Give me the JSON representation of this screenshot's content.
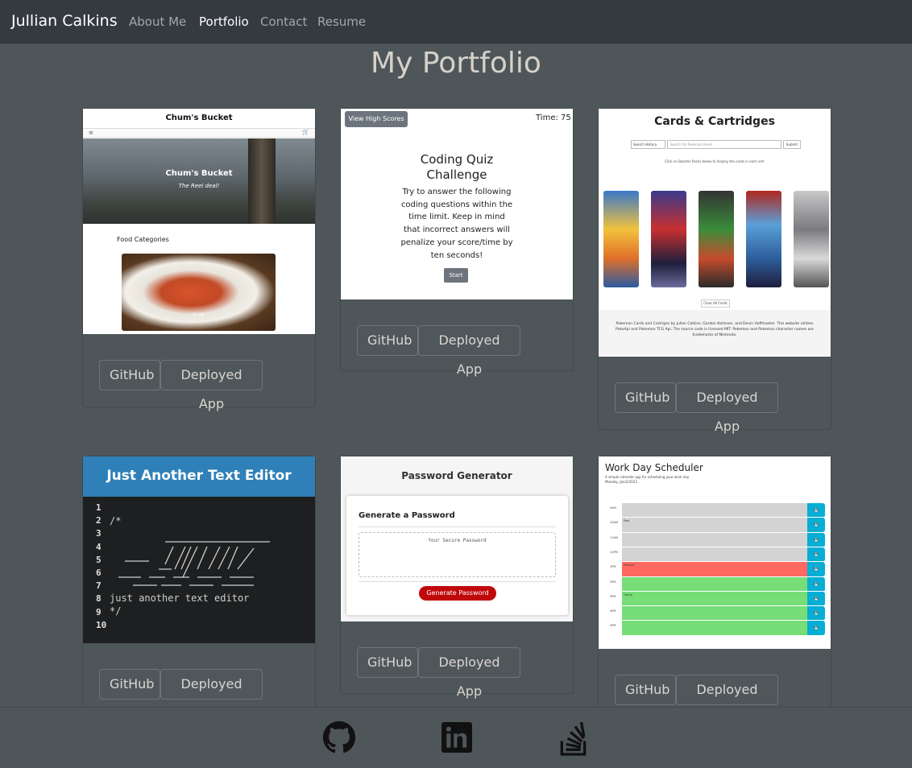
{
  "nav": {
    "brand": "Jullian Calkins",
    "links": [
      "About Me",
      "Portfolio",
      "Contact",
      "Resume"
    ],
    "active": "Portfolio"
  },
  "page_title": "My Portfolio",
  "cards": [
    {
      "id": "chums-bucket",
      "preview": {
        "title": "Chum's Bucket",
        "hero_title": "Chum's Bucket",
        "hero_tagline": "The Reel deal!",
        "section_label": "Food Categories",
        "image_caption": "Crab"
      },
      "github_label": "GitHub",
      "deployed_label": "Deployed App"
    },
    {
      "id": "coding-quiz",
      "preview": {
        "high_scores_label": "View High Scores",
        "timer": "Time: 75",
        "heading": "Coding Quiz Challenge",
        "instructions": "Try to answer the following coding questions within the time limit. Keep in mind that incorrect answers will penalize your score/time by ten seconds!",
        "start_label": "Start"
      },
      "github_label": "GitHub",
      "deployed_label": "Deployed App"
    },
    {
      "id": "cards-and-cartridges",
      "preview": {
        "heading": "Cards & Cartridges",
        "select_label": "Search History",
        "search_placeholder": "Search for Pokemon Here!",
        "submit_label": "Submit",
        "hint": "Click on Booster Packs below to display the cards in each set!",
        "clear_label": "Clear All Cards",
        "footer_text": "Pokemon Cards and Cartriges by Julian Calkins, Gordon Karlsson, and Devin Hoffmaster. This website utilizes PokeApi and Pokemon TCG Api. The source code is licensed MIT. Pokemon and Pokemon character names are trademarks of Nintendo."
      },
      "github_label": "GitHub",
      "deployed_label": "Deployed App"
    },
    {
      "id": "jate",
      "preview": {
        "heading": "Just Another Text Editor",
        "line_numbers": "1\n2\n3\n4\n5\n6\n7\n8\n9\n10",
        "code_top": "/*",
        "code_bottom": "just another text editor\n*/"
      },
      "github_label": "GitHub",
      "deployed_label": "Deployed App"
    },
    {
      "id": "password-generator",
      "preview": {
        "heading": "Password Generator",
        "subheading": "Generate a Password",
        "placeholder": "Your Secure Password",
        "generate_label": "Generate Password"
      },
      "github_label": "GitHub",
      "deployed_label": "Deployed App"
    },
    {
      "id": "work-day-scheduler",
      "preview": {
        "heading": "Work Day Scheduler",
        "subtitle": "A simple calendar app for scheduling your work day",
        "date": "Monday, Jan/2/2023",
        "hours": [
          "9AM",
          "10AM",
          "11AM",
          "12PM",
          "1PM",
          "2PM",
          "3PM",
          "4PM",
          "5PM"
        ],
        "row_notes": [
          "",
          "Past",
          "",
          "",
          "Present",
          "",
          "Future",
          "",
          ""
        ],
        "colors": {
          "past": "#d3d3d3",
          "present": "#ff6961",
          "future": "#77dd77",
          "save": "#06aed5"
        }
      },
      "github_label": "GitHub",
      "deployed_label": "Deployed App"
    }
  ],
  "footer": {
    "icons": [
      "github-icon",
      "linkedin-icon",
      "stackoverflow-icon"
    ]
  },
  "colors": {
    "background": "#4f5659",
    "navbar": "#343a40",
    "title": "#d6d1c9"
  }
}
